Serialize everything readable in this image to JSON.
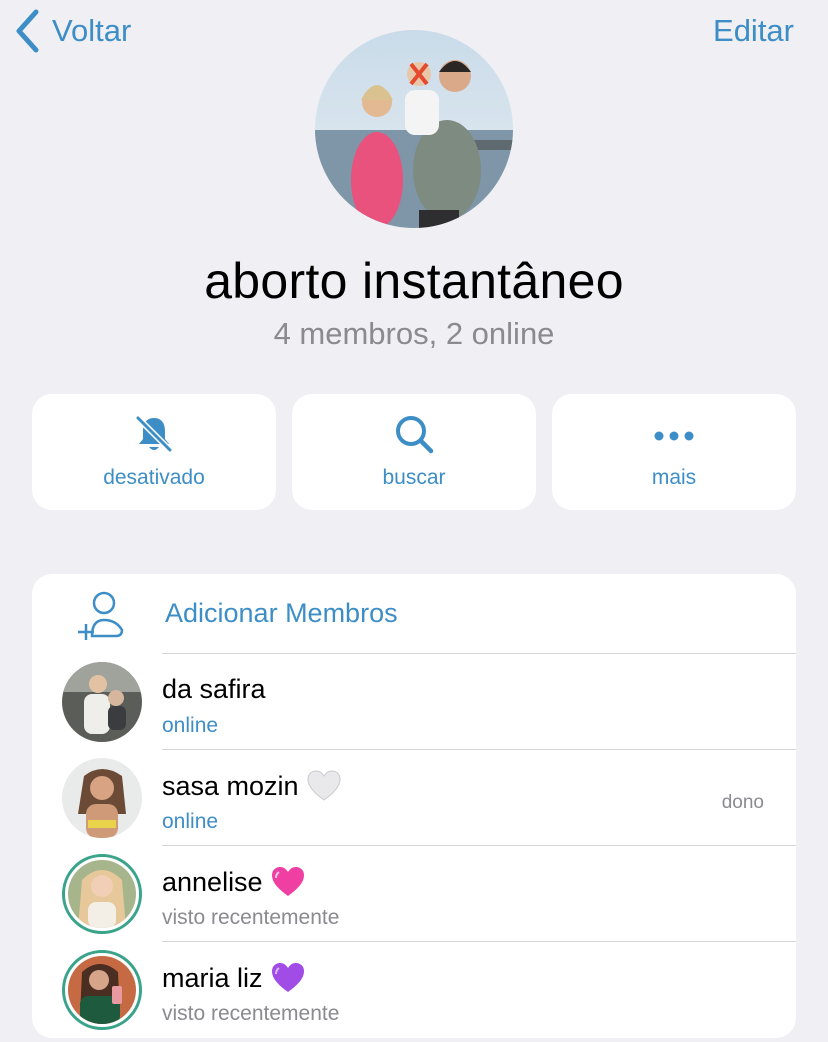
{
  "nav": {
    "back_label": "Voltar",
    "edit_label": "Editar"
  },
  "group": {
    "title": "aborto instantâneo",
    "subtitle": "4 membros, 2 online"
  },
  "actions": [
    {
      "label": "desativado",
      "icon": "bell-slash-icon"
    },
    {
      "label": "buscar",
      "icon": "search-icon"
    },
    {
      "label": "mais",
      "icon": "more-dots-icon"
    }
  ],
  "members_card": {
    "add_label": "Adicionar Membros",
    "members": [
      {
        "name": "da safira",
        "emoji": "",
        "status": "online",
        "role": ""
      },
      {
        "name": "sasa mozin",
        "emoji": "white-heart",
        "status": "online",
        "role": "dono"
      },
      {
        "name": "annelise",
        "emoji": "pink-heart",
        "status": "visto recentemente",
        "role": ""
      },
      {
        "name": "maria liz",
        "emoji": "purple-heart",
        "status": "visto recentemente",
        "role": ""
      }
    ]
  },
  "colors": {
    "accent": "#3d8ec7",
    "background": "#efeff4",
    "secondary_text": "#8a8a8f",
    "story_ring": "#3aa38a"
  }
}
